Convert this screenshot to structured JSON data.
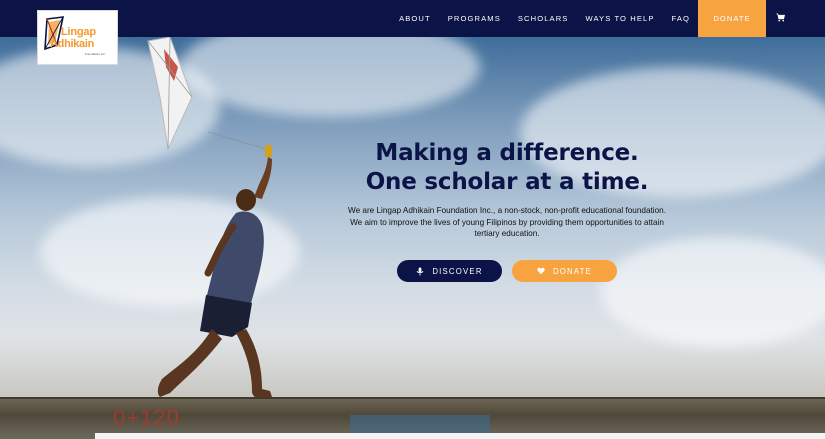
{
  "brand": {
    "logo_line1": "Lingap",
    "logo_line2": "Adhikain",
    "logo_line3": "Foundation Inc."
  },
  "nav": {
    "items": [
      "ABOUT",
      "PROGRAMS",
      "SCHOLARS",
      "WAYS TO HELP",
      "FAQ"
    ],
    "donate_label": "DONATE",
    "cart_icon": "cart-icon"
  },
  "hero": {
    "headline_line1": "Making a difference.",
    "headline_line2": "One scholar at a time.",
    "description": "We are Lingap Adhikain Foundation Inc., a non-stock, non-profit educational foundation. We aim to improve the lives of young Filipinos by providing them opportunities to attain tertiary education.",
    "discover_label": "DISCOVER",
    "donate_label": "DONATE",
    "wall_graffiti": "0+120"
  },
  "colors": {
    "navy": "#0b1347",
    "orange": "#f7a440"
  }
}
